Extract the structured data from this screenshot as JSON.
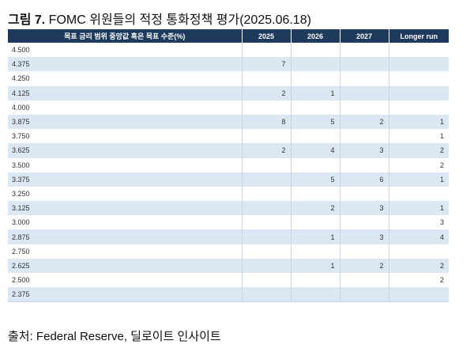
{
  "figure": {
    "label": "그림 7.",
    "title": " FOMC 위원들의 적정 통화정책 평가(2025.06.18)"
  },
  "table": {
    "headers": [
      "목표 금리 범위 중앙값 혹은 목표 수준(%)",
      "2025",
      "2026",
      "2027",
      "Longer run"
    ],
    "rows": [
      [
        "4.500",
        "",
        "",
        "",
        ""
      ],
      [
        "4.375",
        "7",
        "",
        "",
        ""
      ],
      [
        "4.250",
        "",
        "",
        "",
        ""
      ],
      [
        "4.125",
        "2",
        "1",
        "",
        ""
      ],
      [
        "4.000",
        "",
        "",
        "",
        ""
      ],
      [
        "3.875",
        "8",
        "5",
        "2",
        "1"
      ],
      [
        "3.750",
        "",
        "",
        "",
        "1"
      ],
      [
        "3.625",
        "2",
        "4",
        "3",
        "2"
      ],
      [
        "3.500",
        "",
        "",
        "",
        "2"
      ],
      [
        "3.375",
        "",
        "5",
        "6",
        "1"
      ],
      [
        "3.250",
        "",
        "",
        "",
        ""
      ],
      [
        "3.125",
        "",
        "2",
        "3",
        "1"
      ],
      [
        "3.000",
        "",
        "",
        "",
        "3"
      ],
      [
        "2.875",
        "",
        "1",
        "3",
        "4"
      ],
      [
        "2.750",
        "",
        "",
        "",
        ""
      ],
      [
        "2.625",
        "",
        "1",
        "2",
        "2"
      ],
      [
        "2.500",
        "",
        "",
        "",
        "2"
      ],
      [
        "2.375",
        "",
        "",
        "",
        ""
      ]
    ]
  },
  "source": "출처: Federal Reserve, 딜로이트 인사이트"
}
